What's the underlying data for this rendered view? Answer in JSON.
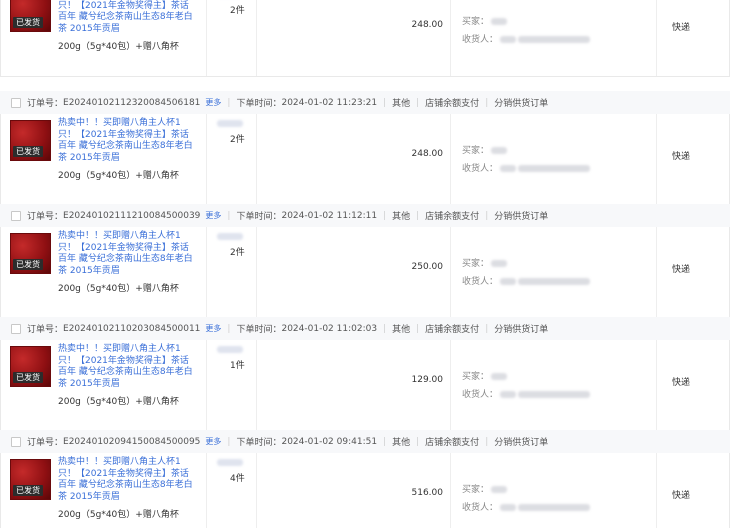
{
  "labels": {
    "order_no": "订单号：",
    "more": "更多",
    "order_time": "下单时间：",
    "buyer": "买家：",
    "receiver": "收货人："
  },
  "product": {
    "title": "热卖中！！买即赠八角主人杯1只！【2021年金物奖得主】茶话百年 藏兮纪念茶南山生态8年老白茶 2015年贡眉",
    "spec": "200g（5g*40包）+赠八角杯",
    "badge": "已发货"
  },
  "orders": [
    {
      "show_header": false,
      "order_no": "",
      "time": "",
      "source": "",
      "payment": "",
      "type": "",
      "quantity": "2件",
      "amount": "248.00",
      "shipping": "快递"
    },
    {
      "show_header": true,
      "order_no": "E20240102112320084506181",
      "time": "2024-01-02 11:23:21",
      "source": "其他",
      "payment": "店铺余额支付",
      "type": "分销供货订单",
      "quantity": "2件",
      "amount": "248.00",
      "shipping": "快递"
    },
    {
      "show_header": true,
      "order_no": "E20240102111210084500039",
      "time": "2024-01-02 11:12:11",
      "source": "其他",
      "payment": "店铺余额支付",
      "type": "分销供货订单",
      "quantity": "2件",
      "amount": "250.00",
      "shipping": "快递"
    },
    {
      "show_header": true,
      "order_no": "E20240102110203084500011",
      "time": "2024-01-02 11:02:03",
      "source": "其他",
      "payment": "店铺余额支付",
      "type": "分销供货订单",
      "quantity": "1件",
      "amount": "129.00",
      "shipping": "快递"
    },
    {
      "show_header": true,
      "order_no": "E20240102094150084500095",
      "time": "2024-01-02 09:41:51",
      "source": "其他",
      "payment": "店铺余额支付",
      "type": "分销供货订单",
      "quantity": "4件",
      "amount": "516.00",
      "shipping": "快递"
    }
  ]
}
